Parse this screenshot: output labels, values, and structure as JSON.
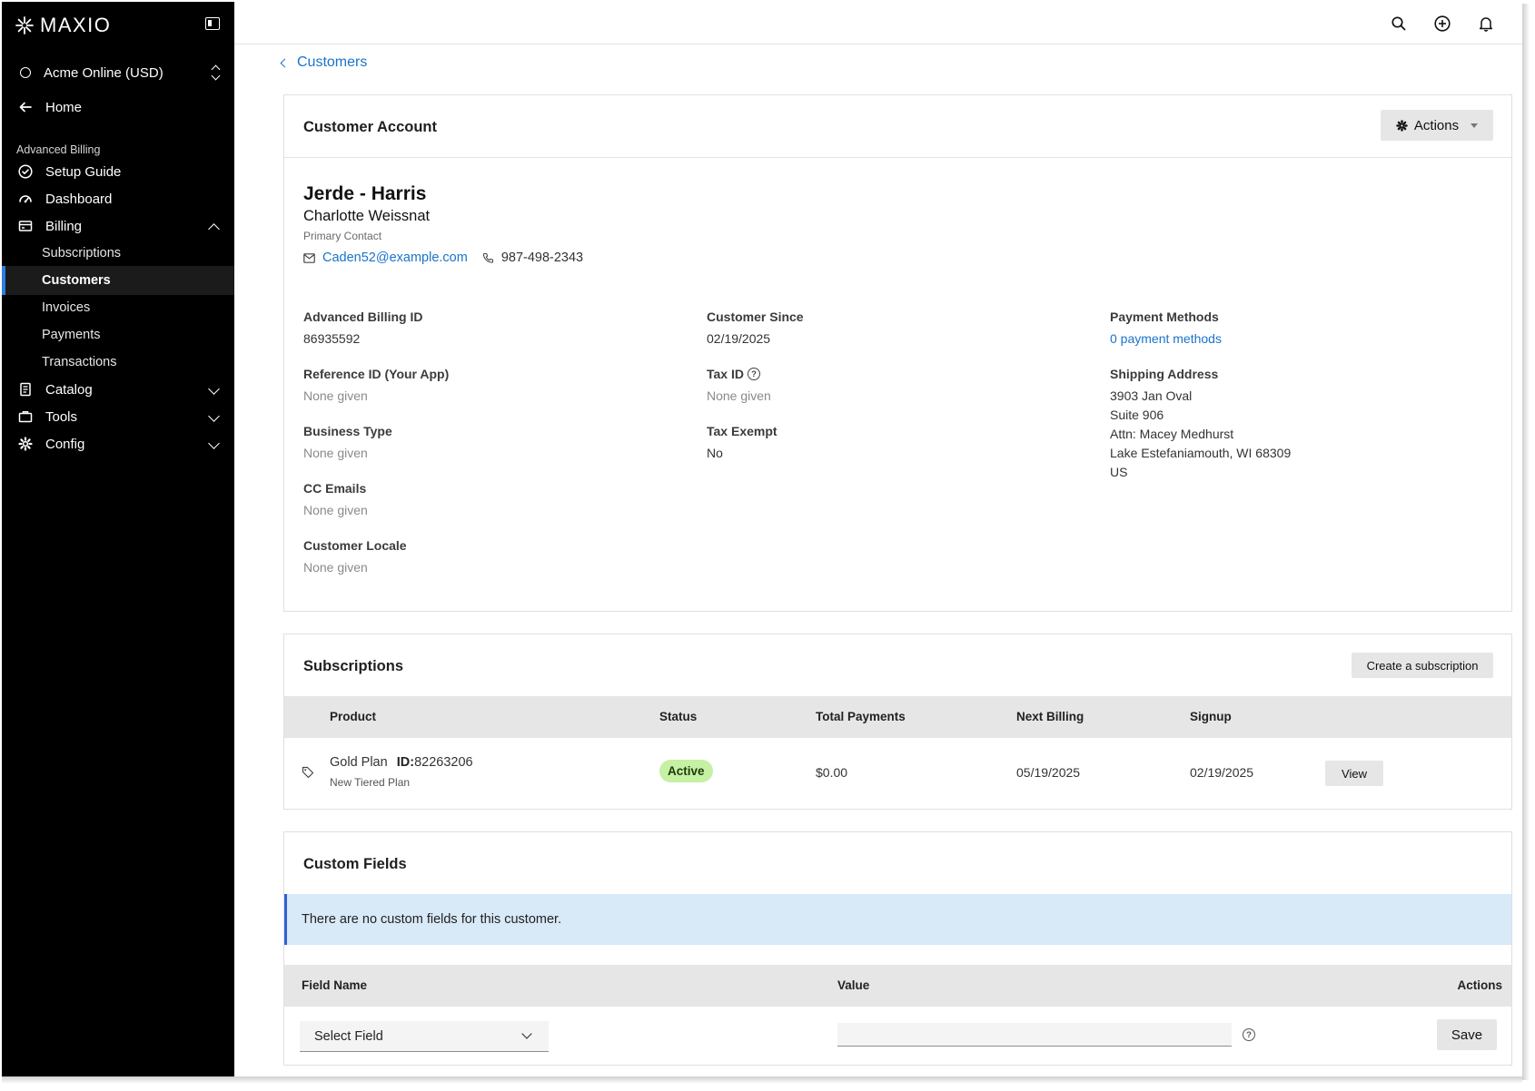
{
  "brand": {
    "name": "MAXIO"
  },
  "sidebar": {
    "org_name": "Acme Online (USD)",
    "home_label": "Home",
    "section_label": "Advanced Billing",
    "items": [
      {
        "label": "Setup Guide",
        "icon": "check-circle-icon"
      },
      {
        "label": "Dashboard",
        "icon": "gauge-icon"
      },
      {
        "label": "Billing",
        "icon": "billing-icon",
        "expanded": true
      },
      {
        "label": "Catalog",
        "icon": "catalog-icon"
      },
      {
        "label": "Tools",
        "icon": "briefcase-icon"
      },
      {
        "label": "Config",
        "icon": "gear-icon"
      }
    ],
    "billing_subitems": [
      "Subscriptions",
      "Customers",
      "Invoices",
      "Payments",
      "Transactions"
    ],
    "active_subitem": "Customers",
    "accent_color": "#2f7de0"
  },
  "topbar": {
    "icons": [
      "search-icon",
      "add-circle-icon",
      "bell-icon"
    ]
  },
  "breadcrumb": {
    "label": "Customers"
  },
  "customer_card": {
    "title": "Customer Account",
    "actions_label": "Actions",
    "customer_name": "Jerde - Harris",
    "contact_name": "Charlotte Weissnat",
    "contact_role": "Primary Contact",
    "email": "Caden52@example.com",
    "phone": "987-498-2343",
    "fields": {
      "billing_id_label": "Advanced Billing ID",
      "billing_id": "86935592",
      "reference_id_label": "Reference ID (Your App)",
      "reference_id": "None given",
      "business_type_label": "Business Type",
      "business_type": "None given",
      "cc_emails_label": "CC Emails",
      "cc_emails": "None given",
      "locale_label": "Customer Locale",
      "locale": "None given",
      "customer_since_label": "Customer Since",
      "customer_since": "02/19/2025",
      "tax_id_label": "Tax ID",
      "tax_id": "None given",
      "tax_exempt_label": "Tax Exempt",
      "tax_exempt": "No",
      "payment_methods_label": "Payment Methods",
      "payment_methods": "0 payment methods",
      "shipping_label": "Shipping Address",
      "shipping_lines": [
        "3903 Jan Oval",
        "Suite 906",
        "Attn: Macey Medhurst",
        "Lake Estefaniamouth, WI 68309",
        "US"
      ]
    }
  },
  "subscriptions_card": {
    "title": "Subscriptions",
    "create_label": "Create a subscription",
    "columns": [
      "Product",
      "Status",
      "Total Payments",
      "Next Billing",
      "Signup"
    ],
    "rows": [
      {
        "product": "Gold Plan",
        "id_label": "ID:",
        "id": "82263206",
        "plan_type": "New Tiered Plan",
        "status": "Active",
        "total_payments": "$0.00",
        "next_billing": "05/19/2025",
        "signup": "02/19/2025",
        "view_label": "View"
      }
    ],
    "status_color": "#c6f0a4"
  },
  "custom_fields_card": {
    "title": "Custom Fields",
    "notice": "There are no custom fields for this customer.",
    "columns": [
      "Field Name",
      "Value",
      "Actions"
    ],
    "select_value": "Select Field",
    "value_input": "",
    "save_label": "Save",
    "notice_color": "#d8e9f8"
  }
}
